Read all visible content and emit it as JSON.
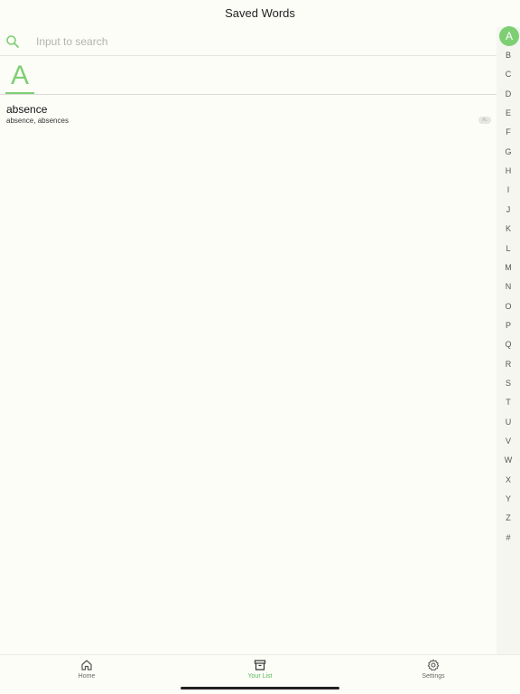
{
  "header": {
    "title": "Saved Words"
  },
  "search": {
    "placeholder": "Input to search",
    "icon": "search-icon"
  },
  "section": {
    "letter": "A"
  },
  "words": [
    {
      "word": "absence",
      "forms": "absence, absences",
      "badge": "AL"
    }
  ],
  "alphabet_index": {
    "letters": [
      "A",
      "B",
      "C",
      "D",
      "E",
      "F",
      "G",
      "H",
      "I",
      "J",
      "K",
      "L",
      "M",
      "N",
      "O",
      "P",
      "Q",
      "R",
      "S",
      "T",
      "U",
      "V",
      "W",
      "X",
      "Y",
      "Z",
      "#"
    ],
    "active": "A"
  },
  "tabs": [
    {
      "label": "Home",
      "icon": "home-icon",
      "active": false
    },
    {
      "label": "Your List",
      "icon": "archive-box-icon",
      "active": true
    },
    {
      "label": "Settings",
      "icon": "gear-icon",
      "active": false
    }
  ],
  "colors": {
    "accent": "#7ecf74",
    "background": "#fdfdf8",
    "text": "#222222"
  }
}
